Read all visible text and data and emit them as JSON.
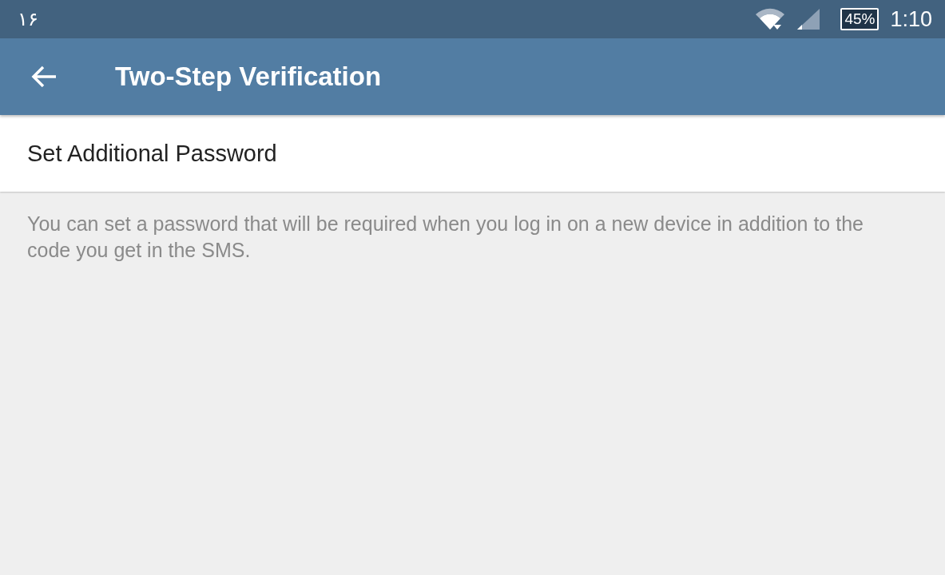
{
  "status_bar": {
    "notification": "۱۶",
    "battery": "45%",
    "time": "1:10"
  },
  "app_bar": {
    "title": "Two-Step Verification"
  },
  "items": [
    {
      "label": "Set Additional Password"
    }
  ],
  "description": "You can set a password that will be required when you log in on a new device in addition to the code you get in the SMS."
}
